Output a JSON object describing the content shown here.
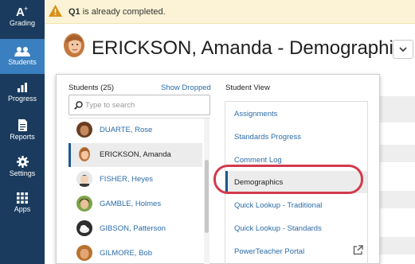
{
  "nav": {
    "items": [
      {
        "label": "Grading",
        "icon": "grading-icon"
      },
      {
        "label": "Students",
        "icon": "students-icon"
      },
      {
        "label": "Progress",
        "icon": "progress-icon"
      },
      {
        "label": "Reports",
        "icon": "reports-icon"
      },
      {
        "label": "Settings",
        "icon": "settings-icon"
      },
      {
        "label": "Apps",
        "icon": "apps-icon"
      }
    ],
    "active": "Students"
  },
  "alert": {
    "bold": "Q1",
    "text": " is already completed."
  },
  "header": {
    "title": "ERICKSON, Amanda - Demographics"
  },
  "students_panel": {
    "heading": "Students (25)",
    "show_dropped": "Show Dropped",
    "search_placeholder": "Type to search",
    "students": [
      {
        "name": "DUARTE, Rose"
      },
      {
        "name": "ERICKSON, Amanda",
        "selected": true
      },
      {
        "name": "FISHER, Heyes"
      },
      {
        "name": "GAMBLE, Holmes"
      },
      {
        "name": "GIBSON, Patterson"
      },
      {
        "name": "GILMORE, Bob"
      }
    ]
  },
  "student_view": {
    "heading": "Student View",
    "items": [
      {
        "label": "Assignments"
      },
      {
        "label": "Standards Progress"
      },
      {
        "label": "Comment Log"
      },
      {
        "label": "Demographics",
        "active": true
      },
      {
        "label": "Quick Lookup - Traditional"
      },
      {
        "label": "Quick Lookup - Standards"
      },
      {
        "label": "PowerTeacher Portal",
        "external": true
      }
    ]
  },
  "colors": {
    "nav_bg": "#1a3b5e",
    "nav_active": "#3a7fbf",
    "link": "#2b6ca8",
    "highlight": "#d23a4d",
    "alert_bg": "#fcf3d6"
  }
}
